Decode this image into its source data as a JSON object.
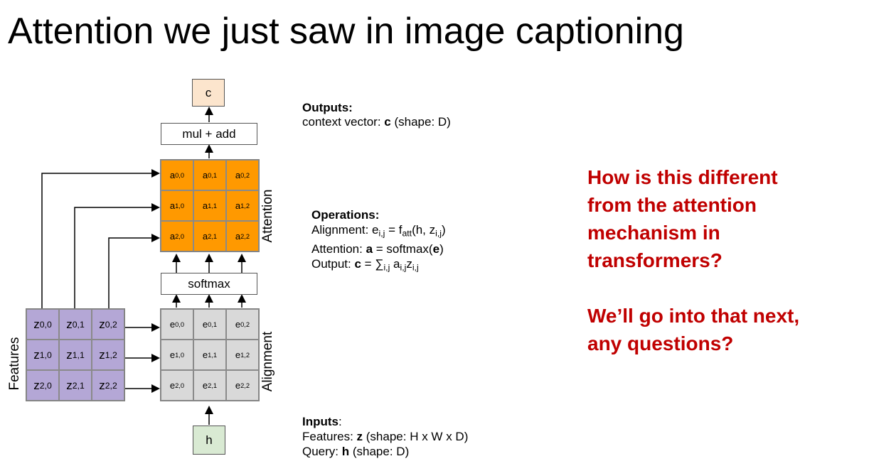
{
  "slide_title": "Attention we just saw in image captioning",
  "diagram": {
    "output_box": "c",
    "mul_add_box": "mul + add",
    "softmax_box": "softmax",
    "input_box": "h",
    "features_label": "Features",
    "alignment_label": "Alignment",
    "attention_label": "Attention",
    "features_grid": [
      [
        "z",
        "0,0"
      ],
      [
        "z",
        "0,1"
      ],
      [
        "z",
        "0,2"
      ],
      [
        "z",
        "1,0"
      ],
      [
        "z",
        "1,1"
      ],
      [
        "z",
        "1,2"
      ],
      [
        "z",
        "2,0"
      ],
      [
        "z",
        "2,1"
      ],
      [
        "z",
        "2,2"
      ]
    ],
    "alignment_grid": [
      [
        "e",
        "0,0"
      ],
      [
        "e",
        "0,1"
      ],
      [
        "e",
        "0,2"
      ],
      [
        "e",
        "1,0"
      ],
      [
        "e",
        "1,1"
      ],
      [
        "e",
        "1,2"
      ],
      [
        "e",
        "2,0"
      ],
      [
        "e",
        "2,1"
      ],
      [
        "e",
        "2,2"
      ]
    ],
    "attention_grid": [
      [
        "a",
        "0,0"
      ],
      [
        "a",
        "0,1"
      ],
      [
        "a",
        "0,2"
      ],
      [
        "a",
        "1,0"
      ],
      [
        "a",
        "1,1"
      ],
      [
        "a",
        "1,2"
      ],
      [
        "a",
        "2,0"
      ],
      [
        "a",
        "2,1"
      ],
      [
        "a",
        "2,2"
      ]
    ]
  },
  "outputs": {
    "heading": "Outputs:",
    "line_prefix": "context vector: ",
    "line_var": "c",
    "line_suffix": " (shape: D)"
  },
  "operations": {
    "heading": "Operations:",
    "alignment_prefix": "Alignment: e",
    "alignment_sub1": "i,j",
    "alignment_mid": " = f",
    "alignment_sub2": "att",
    "alignment_tail1": "(h, z",
    "alignment_sub3": "i,j",
    "alignment_tail2": ")",
    "attention_prefix": "Attention: ",
    "attention_var": "a",
    "attention_mid": " = softmax(",
    "attention_var2": "e",
    "attention_tail": ")",
    "output_prefix": "Output: ",
    "output_var": "c",
    "output_mid": " = ∑",
    "output_sub1": "i,j",
    "output_a": " a",
    "output_sub2": "i,j",
    "output_z": "z",
    "output_sub3": "i,j"
  },
  "inputs": {
    "heading": "Inputs",
    "colon": ":",
    "features_prefix": "Features: ",
    "features_var": "z",
    "features_suffix": " (shape: H x W x D)",
    "query_prefix": "Query: ",
    "query_var": "h",
    "query_suffix": " (shape: D)"
  },
  "question": {
    "line1": "How is this different",
    "line2": "from the attention",
    "line3": "mechanism in",
    "line4": "transformers?",
    "line5": "We’ll go into that next,",
    "line6": "any questions?"
  },
  "colors": {
    "features_fill": "#b4a7d6",
    "alignment_fill": "#d9d9d9",
    "attention_fill": "#ff9900",
    "output_fill": "#fce5cd",
    "input_fill": "#d9ead3",
    "question_text": "#c00000"
  }
}
